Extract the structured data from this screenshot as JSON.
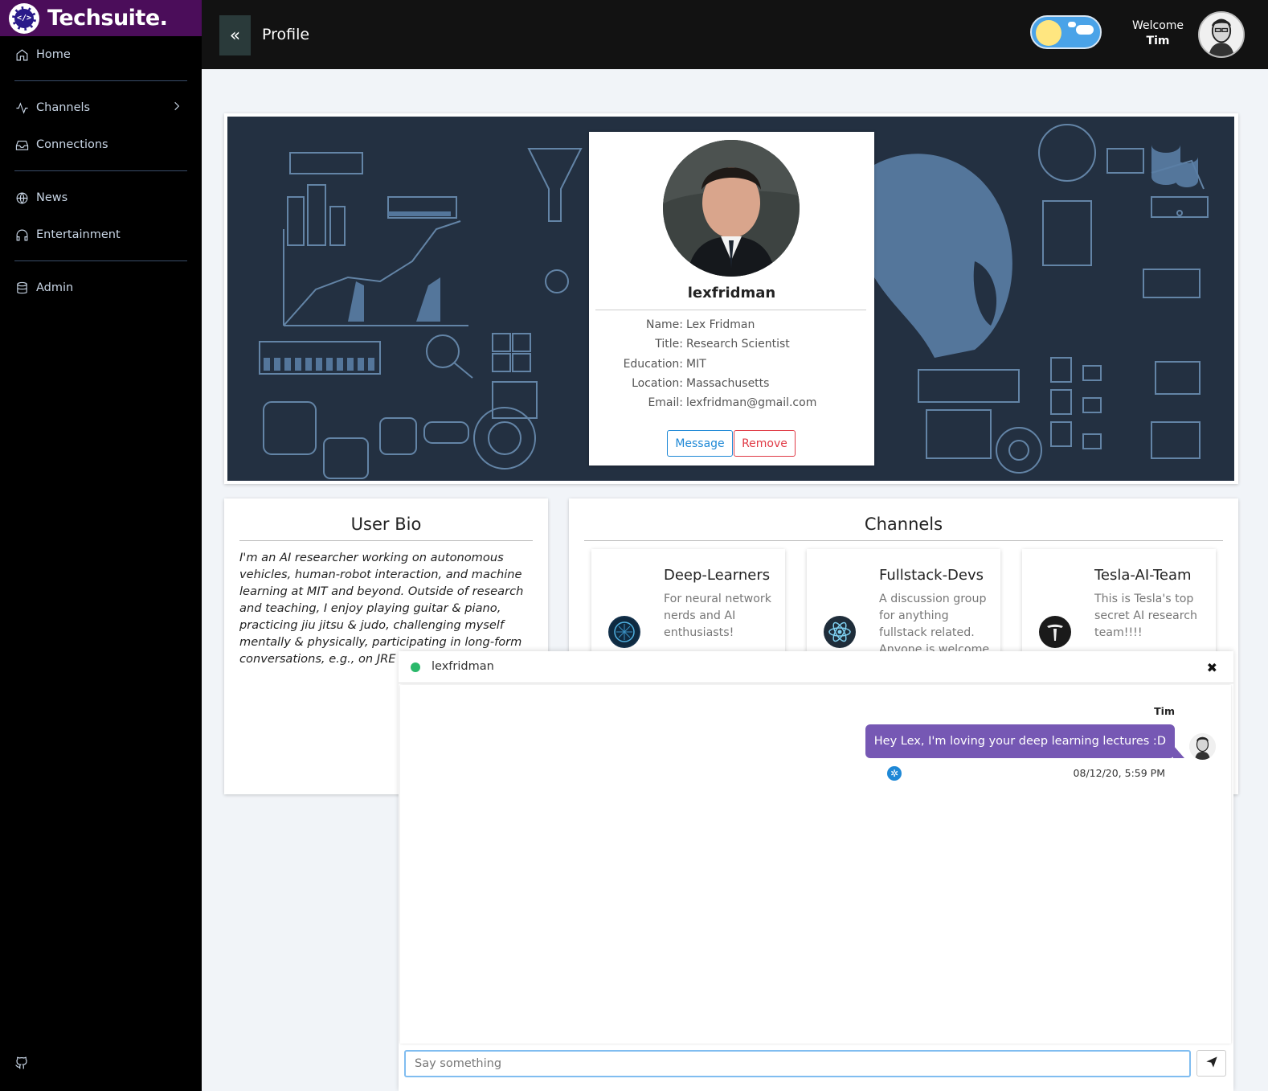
{
  "brand": {
    "name": "Techsuite.",
    "logo_glyph": "</>"
  },
  "sidebar": {
    "items": [
      {
        "label": "Home",
        "icon": "home-icon"
      },
      {
        "label": "Channels",
        "icon": "activity-icon"
      },
      {
        "label": "Connections",
        "icon": "inbox-icon"
      },
      {
        "label": "News",
        "icon": "globe-icon"
      },
      {
        "label": "Entertainment",
        "icon": "headphones-icon"
      },
      {
        "label": "Admin",
        "icon": "database-icon"
      }
    ],
    "footer_icon": "github-icon"
  },
  "header": {
    "collapse_glyph": "«",
    "title": "Profile",
    "welcome": "Welcome",
    "username": "Tim"
  },
  "profile": {
    "username": "lexfridman",
    "fields": [
      {
        "key": "Name:",
        "value": "Lex Fridman"
      },
      {
        "key": "Title:",
        "value": "Research Scientist"
      },
      {
        "key": "Education:",
        "value": "MIT"
      },
      {
        "key": "Location:",
        "value": "Massachusetts"
      },
      {
        "key": "Email:",
        "value": "lexfridman@gmail.com"
      }
    ],
    "message_label": "Message",
    "remove_label": "Remove"
  },
  "bio": {
    "title": "User Bio",
    "text": "I'm an AI researcher working on autonomous vehicles, human-robot interaction, and machine learning at MIT and beyond. Outside of research and teaching, I enjoy playing guitar & piano, practicing jiu jitsu & judo, challenging myself mentally & physically, participating in long-form conversations, e.g., on JRE"
  },
  "channels": {
    "title": "Channels",
    "items": [
      {
        "name": "Deep-Learners",
        "desc": "For neural network nerds and AI enthusiasts!",
        "color": "#12304a"
      },
      {
        "name": "Fullstack-Devs",
        "desc": "A discussion group for anything fullstack related. Anyone is welcome, apart from",
        "color": "#1f2d3a"
      },
      {
        "name": "Tesla-AI-Team",
        "desc": "This is Tesla's top secret AI research team!!!!",
        "color": "#1a1a1a"
      }
    ]
  },
  "chat": {
    "user": "lexfridman",
    "close_glyph": "✖",
    "messages": [
      {
        "author": "Tim",
        "text": "Hey Lex, I'm loving your deep learning lectures :D",
        "time": "08/12/20, 5:59 PM"
      }
    ],
    "input_placeholder": "Say something"
  },
  "colors": {
    "brand_bar": "#4b0d5a",
    "sidebar_bg": "#000000",
    "topbar_bg": "#121212",
    "bubble": "#7658b4",
    "online": "#2ab86a",
    "message_btn": "#1e88d6",
    "remove_btn": "#e03a45"
  }
}
